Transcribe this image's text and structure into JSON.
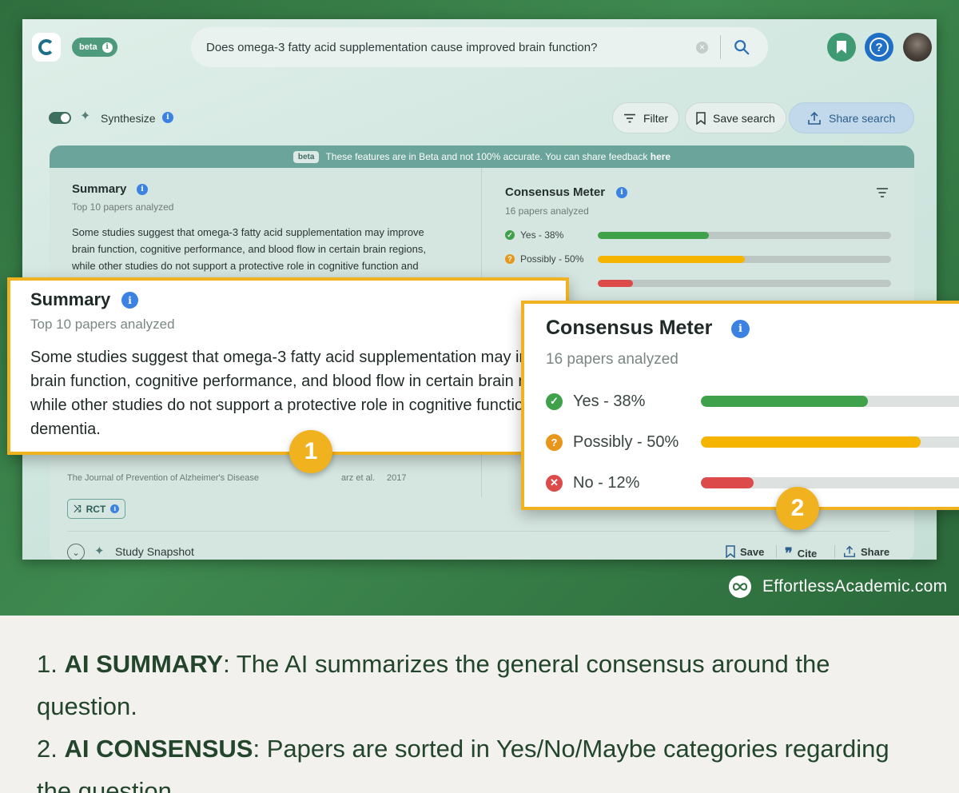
{
  "app": {
    "beta_label": "beta",
    "search_query": "Does omega-3 fatty acid supplementation cause improved brain function?"
  },
  "toolbar": {
    "synthesize_label": "Synthesize",
    "synthesize_enabled": true,
    "filter_label": "Filter",
    "save_search_label": "Save search",
    "share_search_label": "Share search"
  },
  "beta_notice": {
    "tag": "beta",
    "text": "These features are in Beta and not 100% accurate. You can share feedback",
    "link": "here"
  },
  "summary": {
    "title": "Summary",
    "subtitle": "Top 10 papers analyzed",
    "body": "Some studies suggest that omega-3 fatty acid supplementation may improve brain function, cognitive performance, and blood flow in certain brain regions, while other studies do not support a protective role in cognitive function and dementia."
  },
  "consensus": {
    "title": "Consensus Meter",
    "subtitle": "16 papers analyzed",
    "rows": [
      {
        "label": "Yes - 38%",
        "percent": 38,
        "color": "#3fa14a",
        "icon": "check-icon"
      },
      {
        "label": "Possibly - 50%",
        "percent": 50,
        "color": "#f4b400",
        "icon": "question-icon"
      },
      {
        "label": "No - 12%",
        "percent": 12,
        "color": "#dc4a4a",
        "icon": "x-icon"
      }
    ]
  },
  "paper": {
    "journal": "The Journal of Prevention of Alzheimer's Disease",
    "authors": "arz et al.",
    "year": "2017",
    "tag": "RCT"
  },
  "footer_actions": {
    "study_snapshot": "Study Snapshot",
    "save": "Save",
    "cite": "Cite",
    "share": "Share"
  },
  "callouts": {
    "badge_1": "1",
    "badge_2": "2"
  },
  "brand": "EffortlessAcademic.com",
  "notes": [
    {
      "num": "1.",
      "title": "AI SUMMARY",
      "text": ": The AI summarizes the general consensus around the question."
    },
    {
      "num": "2.",
      "title": "AI CONSENSUS",
      "text": ": Papers are sorted in Yes/No/Maybe categories regarding the question."
    }
  ],
  "colors": {
    "banner_green": "#2f6e3e",
    "accent_yellow": "#f0b21e",
    "info_blue": "#3b82e3",
    "note_text": "#22452c"
  }
}
